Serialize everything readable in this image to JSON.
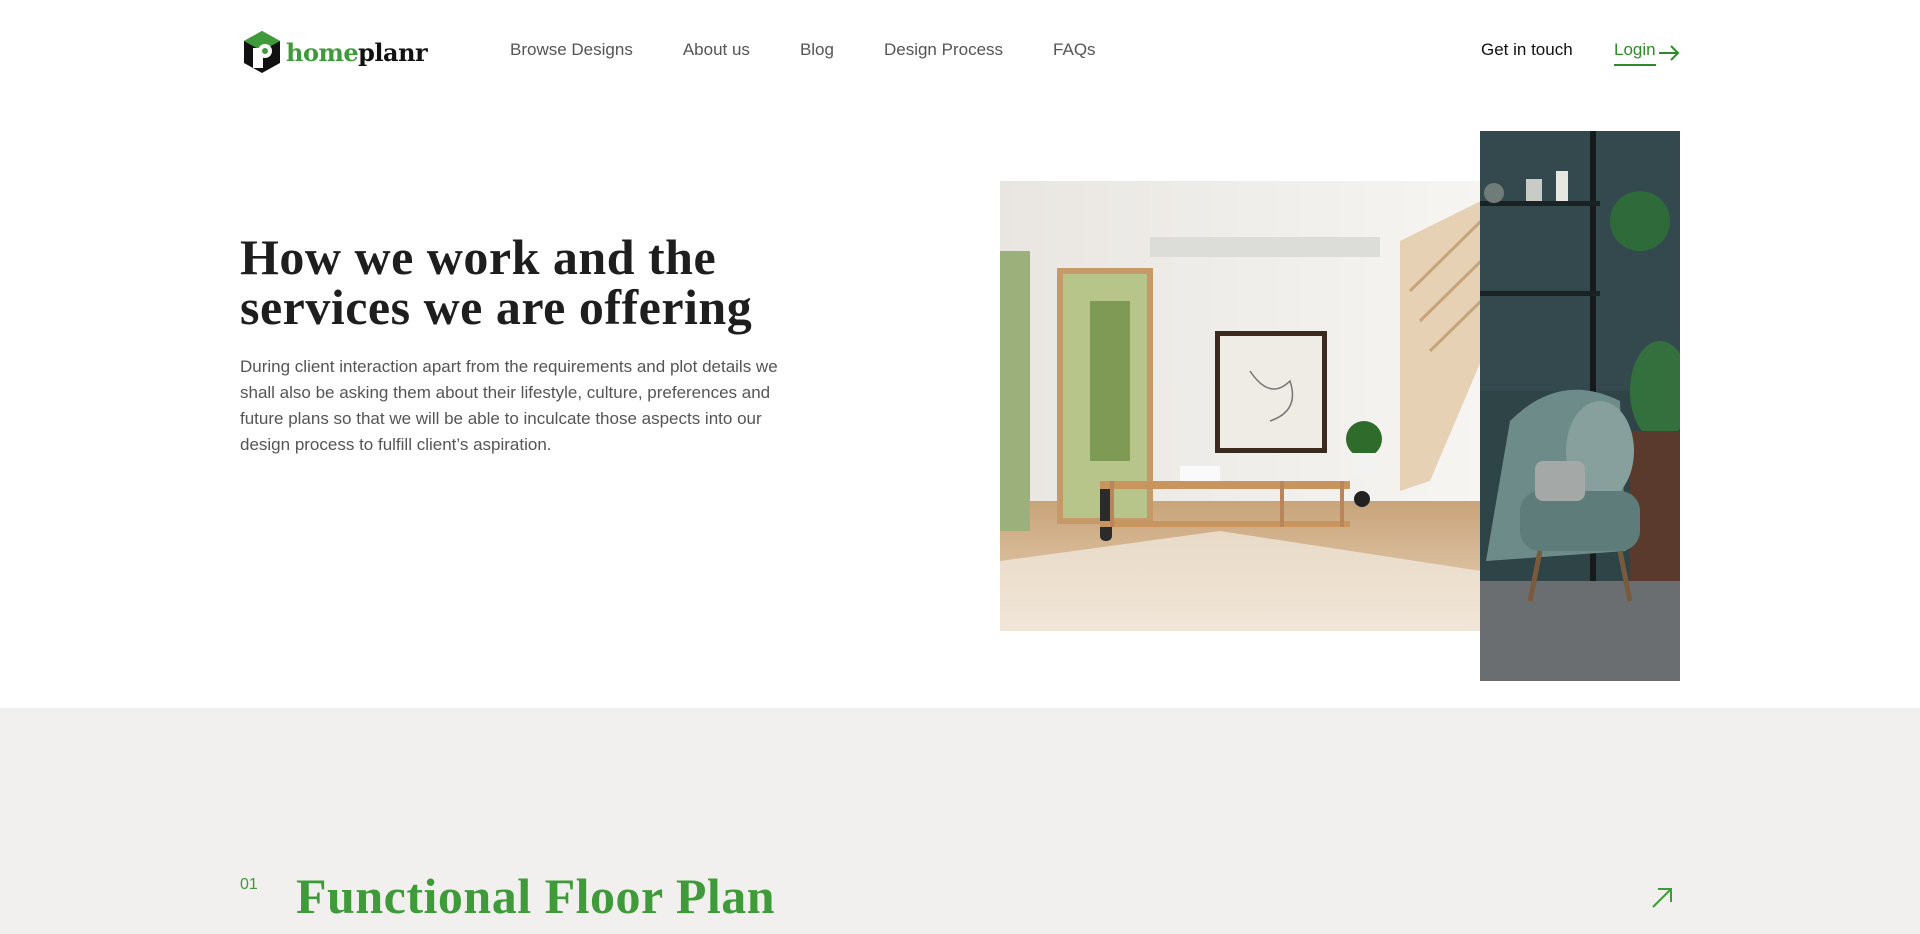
{
  "brand": {
    "name_part1": "home",
    "name_part2": "planr",
    "accent": "#3f9b39"
  },
  "nav": {
    "links": [
      "Browse Designs",
      "About us",
      "Blog",
      "Design Process",
      "FAQs"
    ],
    "contact_label": "Get in touch",
    "login_label": "Login"
  },
  "hero": {
    "title": "How we work and the services we are offering",
    "description": "During client interaction apart from the requirements and plot details we shall also be asking them about their lifestyle, culture, preferences and future plans so that we will be able to inculcate those aspects into our design process to fulfill client’s aspiration."
  },
  "services": [
    {
      "number": "01",
      "title": "Functional Floor Plan"
    }
  ],
  "icons": {
    "login": "arrow-right-icon",
    "service": "arrow-up-right-icon"
  }
}
